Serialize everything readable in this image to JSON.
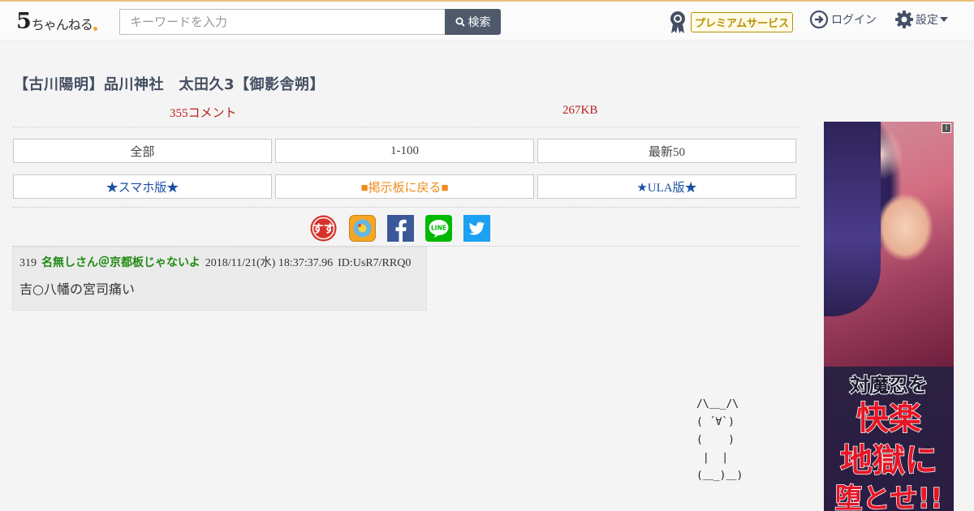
{
  "header": {
    "logo_numeral": "5",
    "logo_text": "ちゃんねる",
    "search_placeholder": "キーワードを入力",
    "search_button": "検索",
    "premium_label": "プレミアムサービス",
    "login_label": "ログイン",
    "settings_label": "設定"
  },
  "thread": {
    "title": "【古川陽明】品川神社　太田久3【御影舎朔】",
    "comment_count": "355コメント",
    "size": "267KB"
  },
  "nav": {
    "row1": [
      "全部",
      "1-100",
      "最新50"
    ],
    "row2": [
      "★スマホ版★",
      "■掲示板に戻る■",
      "★ULA版★"
    ]
  },
  "share": [
    "ss-icon",
    "app-icon",
    "facebook-icon",
    "line-icon",
    "twitter-icon"
  ],
  "post": {
    "number": "319",
    "name": "名無しさん＠京都板じゃないよ",
    "date": "2018/11/21(水) 18:37:37.96",
    "id": "ID:UsR7/RRQ0",
    "body": "吉○八幡の宮司痛い"
  },
  "ascii_art": "/\\＿_/\\\n( ´∀`)\n(    )\n |  | \n(＿_)＿)",
  "ad": {
    "line1": "対魔忍を",
    "line2": "快楽",
    "line3": "地獄に",
    "line4": "堕とせ!!"
  },
  "colors": {
    "accent_line": "#e8c07a",
    "search_button": "#4e5a6a",
    "stat_red": "#b8211b",
    "name_green": "#218a15",
    "link_blue": "#1a4fa1",
    "link_orange": "#f08a1b",
    "premium_gold": "#b8900a"
  }
}
